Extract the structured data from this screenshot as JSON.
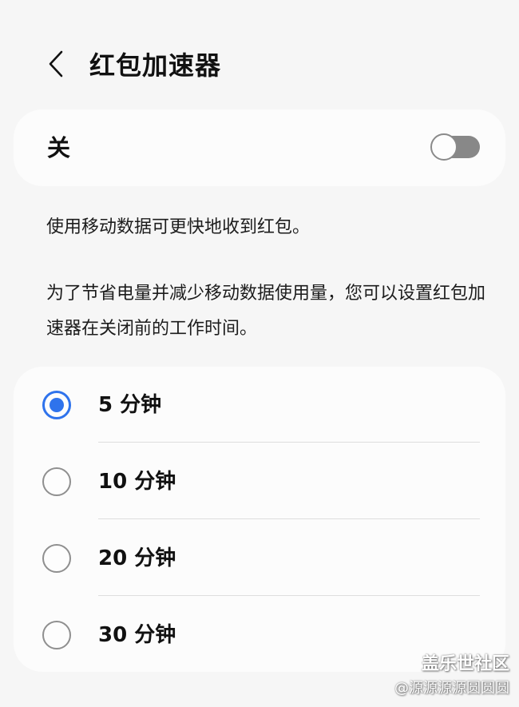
{
  "header": {
    "back_icon": "chevron-left-icon",
    "title": "红包加速器"
  },
  "toggle": {
    "label": "关",
    "state": "off",
    "track_color": "#888888"
  },
  "description": {
    "line1": "使用移动数据可更快地收到红包。",
    "line2": "为了节省电量并减少移动数据使用量，您可以设置红包加速器在关闭前的工作时间。"
  },
  "options": {
    "accent_color": "#2f73ec",
    "selected_index": 0,
    "items": [
      {
        "label": "5 分钟",
        "selected": true
      },
      {
        "label": "10 分钟",
        "selected": false
      },
      {
        "label": "20 分钟",
        "selected": false
      },
      {
        "label": "30 分钟",
        "selected": false
      }
    ]
  },
  "watermark": {
    "brand": "盖乐世社区",
    "user": "@源源源源圆圆圆"
  }
}
